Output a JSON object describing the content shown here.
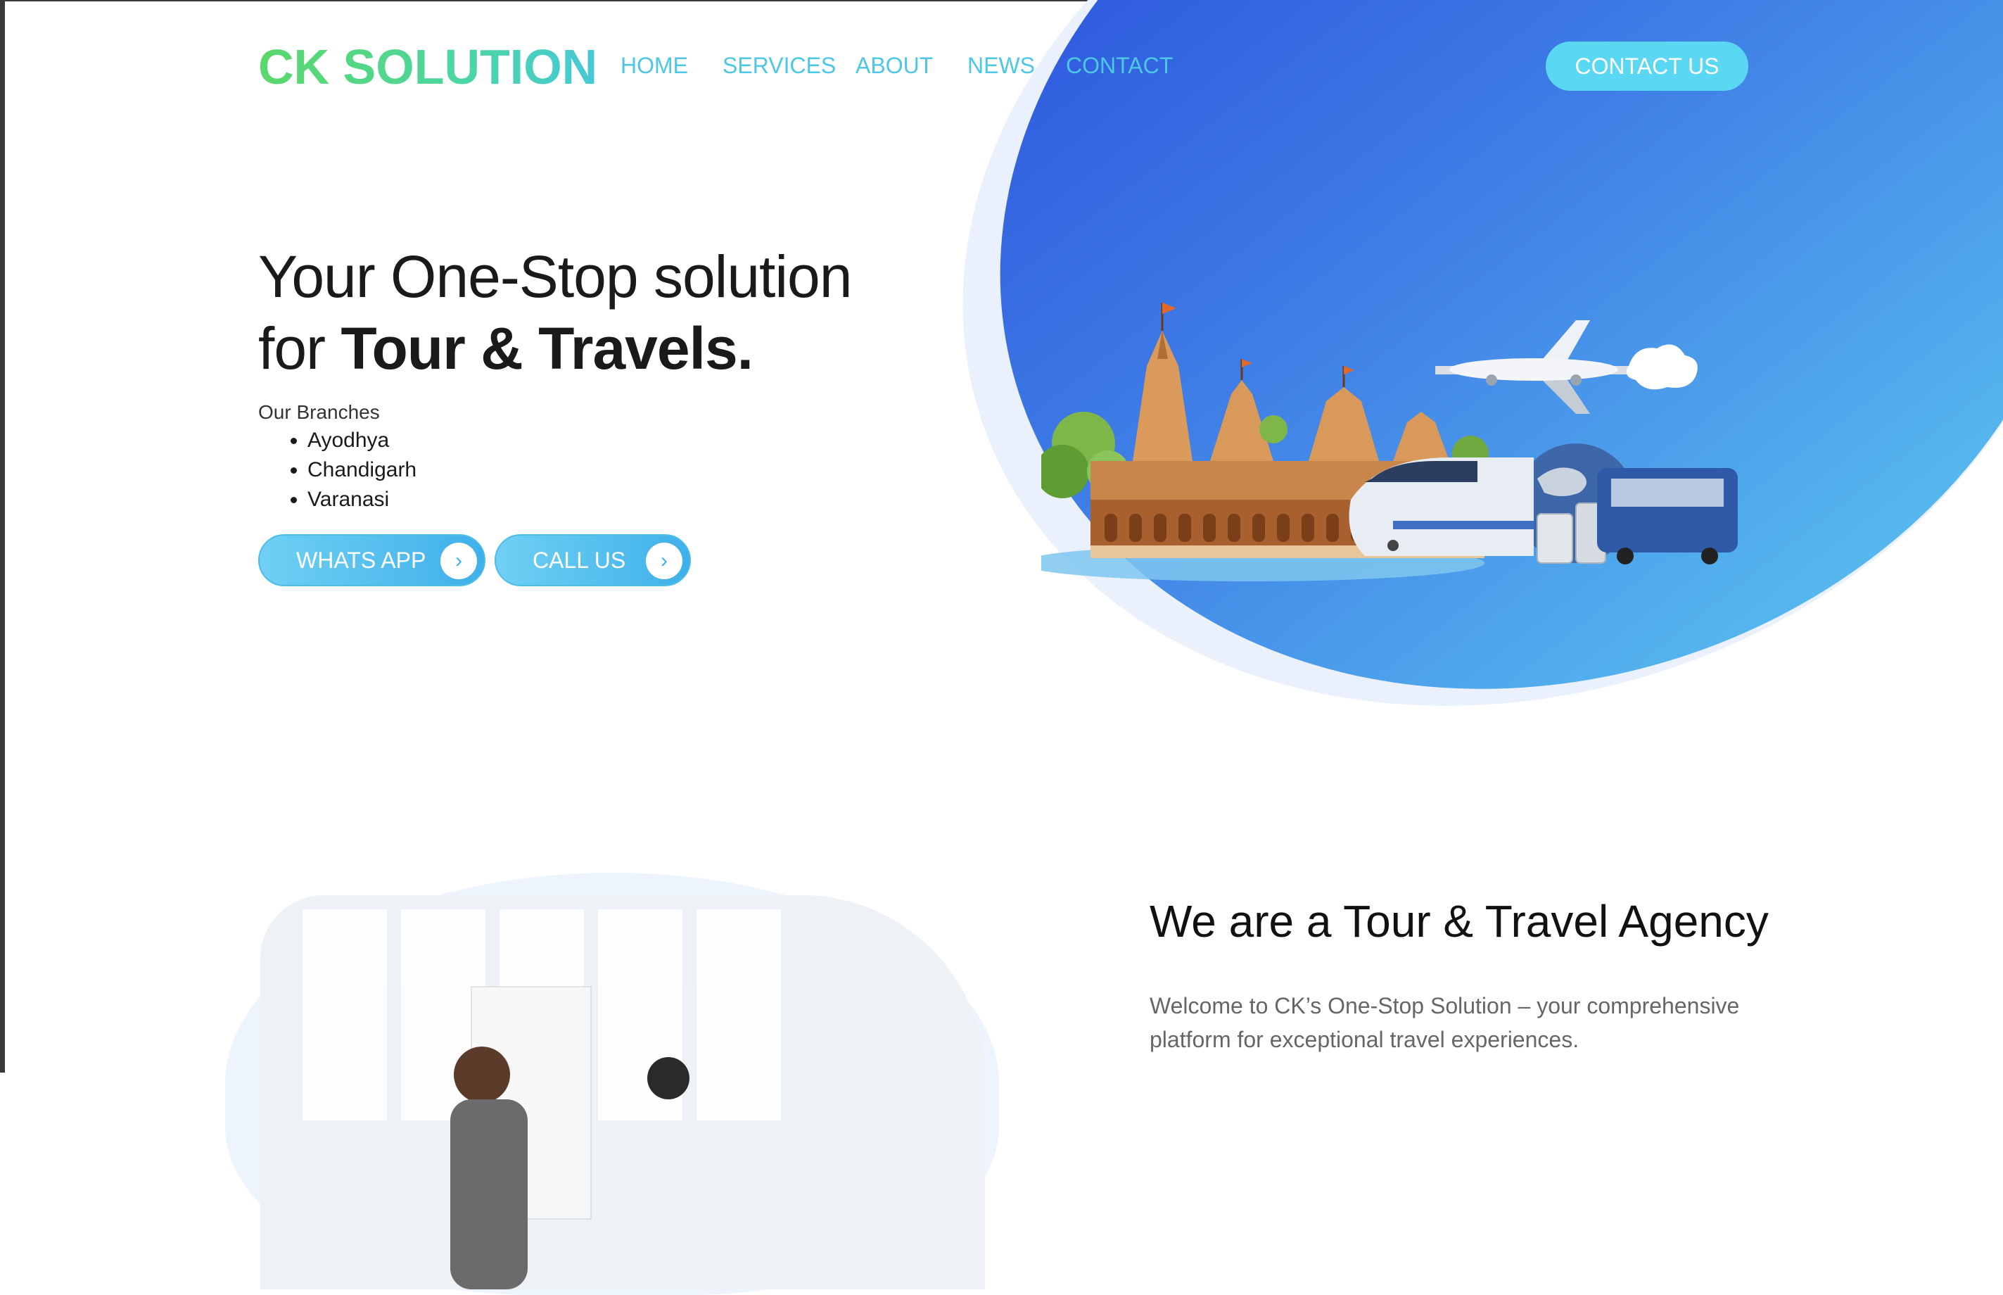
{
  "header": {
    "logo": "CK SOLUTION",
    "nav": [
      "HOME",
      "SERVICES",
      "ABOUT",
      "NEWS",
      "CONTACT"
    ],
    "contact_button": "CONTACT US"
  },
  "hero": {
    "line1": "Your One-Stop solution",
    "line2_prefix": "for ",
    "line2_bold": "Tour & Travels.",
    "branches_title": "Our Branches",
    "branches": [
      "Ayodhya",
      "Chandigarh",
      "Varanasi"
    ],
    "whatsapp_button": "WHATS APP",
    "call_button": "CALL US",
    "arrow_icon": "›"
  },
  "about": {
    "title": "We are a Tour & Travel Agency",
    "text": "Welcome to CK’s One-Stop Solution – your comprehensive platform for exceptional travel experiences."
  },
  "colors": {
    "accent": "#4cc7e4",
    "button": "#5ad8f3",
    "blob_start": "#2a4fdc",
    "blob_end": "#5cc7f0"
  }
}
